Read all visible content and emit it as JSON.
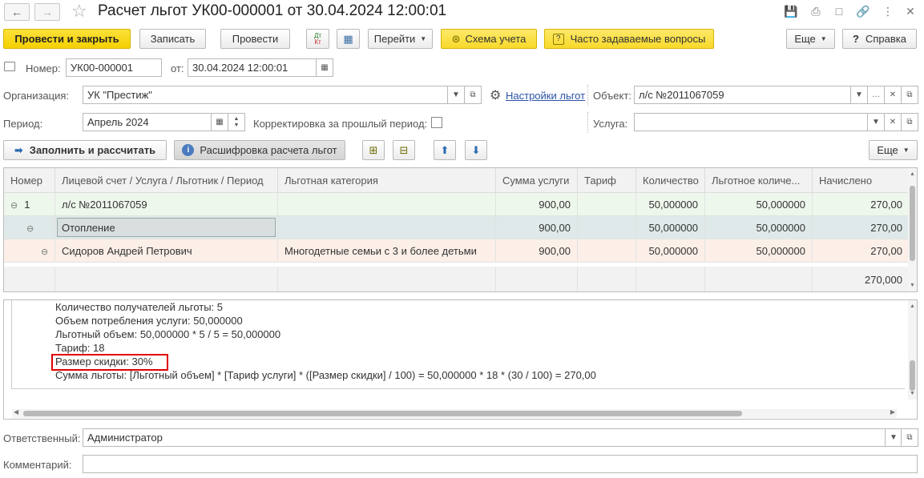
{
  "window": {
    "title": "Расчет льгот УК00-000001 от 30.04.2024 12:00:01",
    "back_icon": "arrow-left-icon",
    "forward_icon": "arrow-right-icon"
  },
  "toolbar": {
    "post_close": "Провести и закрыть",
    "save": "Записать",
    "post": "Провести",
    "dtkt": "Дт Кт",
    "goto": "Перейти",
    "scheme": "Схема учета",
    "faq": "Часто задаваемые вопросы",
    "more": "Еще",
    "help": "Справка"
  },
  "header": {
    "number_label": "Номер:",
    "number_value": "УК00-000001",
    "date_label": "от:",
    "date_value": "30.04.2024 12:00:01",
    "org_label": "Организация:",
    "org_value": "УК \"Престиж\"",
    "settings_link": "Настройки льгот",
    "object_label": "Объект:",
    "object_value": "л/с №2011067059",
    "period_label": "Период:",
    "period_value": "Апрель 2024",
    "correction_label": "Корректировка за прошлый период:",
    "service_label": "Услуга:",
    "service_value": ""
  },
  "actions": {
    "fill_calc": "Заполнить и рассчитать",
    "decode": "Расшифровка расчета льгот",
    "more": "Еще"
  },
  "table": {
    "columns": [
      "Номер",
      "Лицевой счет / Услуга / Льготник / Период",
      "Льготная категория",
      "Сумма услуги",
      "Тариф",
      "Количество",
      "Льготное количе...",
      "Начислено"
    ],
    "rows": [
      {
        "num": "1",
        "name": "л/с №2011067059",
        "category": "",
        "sum": "900,00",
        "tariff": "",
        "qty": "50,000000",
        "lqty": "50,000000",
        "charged": "270,00"
      },
      {
        "num": "",
        "name": "Отопление",
        "category": "",
        "sum": "900,00",
        "tariff": "",
        "qty": "50,000000",
        "lqty": "50,000000",
        "charged": "270,00"
      },
      {
        "num": "",
        "name": "Сидоров Андрей Петрович",
        "category": "Многодетные семьи с 3 и более детьми",
        "sum": "900,00",
        "tariff": "",
        "qty": "50,000000",
        "lqty": "50,000000",
        "charged": "270,00"
      }
    ],
    "total_charged": "270,000"
  },
  "details": {
    "lines": [
      "Количество получателей льготы: 5",
      "Объем потребления услуги: 50,000000",
      "Льготный объем: 50,000000 * 5 / 5 = 50,000000",
      "Тариф: 18",
      "Размер скидки: 30%",
      "Сумма льготы: [Льготный объем] * [Тариф услуги] * ([Размер скидки] / 100) = 50,000000 * 18 * (30 / 100) = 270,00"
    ]
  },
  "footer": {
    "responsible_label": "Ответственный:",
    "responsible_value": "Администратор",
    "comment_label": "Комментарий:",
    "comment_value": ""
  },
  "colors": {
    "row_green": "#eef7ec",
    "row_selected": "#dfe9e9",
    "row_pink": "#fcefe8",
    "highlight_red": "#e00000",
    "primary_yellow": "#f5d000"
  }
}
